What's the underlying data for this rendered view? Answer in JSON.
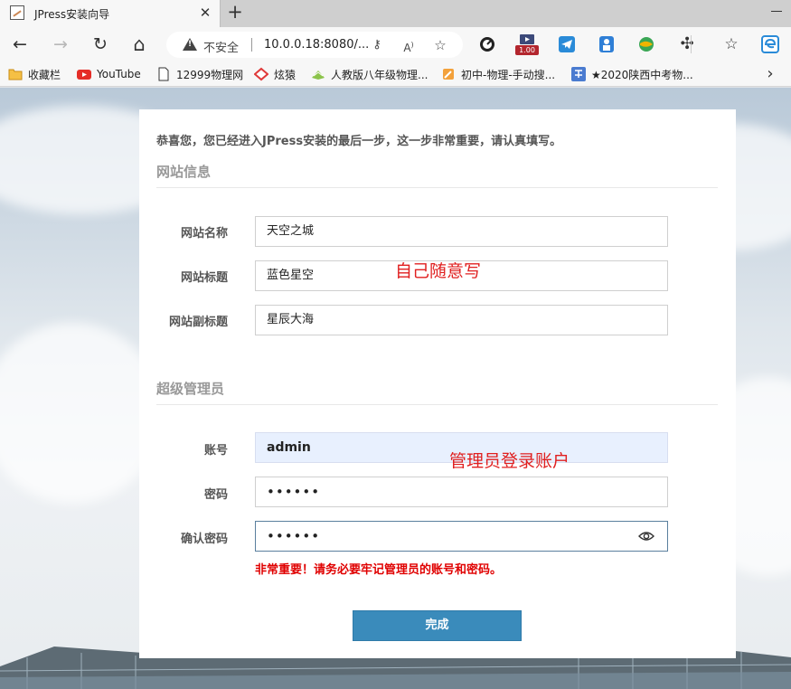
{
  "browser": {
    "tab_title": "JPress安装向导",
    "tab_close": "✕",
    "new_tab": "+",
    "security_label": "不安全",
    "url": "10.0.0.18:8080/...",
    "zoom_badge": "1.00",
    "nav": {
      "back": "←",
      "forward": "→",
      "reload": "↻",
      "home": "⌂"
    },
    "bookmarks": [
      {
        "label": "收藏栏",
        "icon": "folder-icon"
      },
      {
        "label": "YouTube",
        "icon": "youtube-icon"
      },
      {
        "label": "12999物理网",
        "icon": "page-icon"
      },
      {
        "label": "炫猿",
        "icon": "xuanyuan-icon"
      },
      {
        "label": "人教版八年级物理...",
        "icon": "book-icon"
      },
      {
        "label": "初中-物理-手动搜...",
        "icon": "pencil-icon"
      },
      {
        "label": "★2020陕西中考物...",
        "icon": "kao-icon"
      }
    ],
    "more": "›"
  },
  "install": {
    "intro": "恭喜您，您已经进入JPress安装的最后一步，这一步非常重要，请认真填写。",
    "site_section": "网站信息",
    "admin_section": "超级管理员",
    "site_name_label": "网站名称",
    "site_name_value": "天空之城",
    "site_title_label": "网站标题",
    "site_title_value": "蓝色星空",
    "site_subtitle_label": "网站副标题",
    "site_subtitle_value": "星辰大海",
    "account_label": "账号",
    "account_value": "admin",
    "password_label": "密码",
    "password_value": "••••••",
    "confirm_label": "确认密码",
    "confirm_value": "••••••",
    "warning": "非常重要！请务必要牢记管理员的账号和密码。",
    "submit": "完成"
  },
  "annotations": {
    "site_note": "自己随意写",
    "admin_note": "管理员登录账户"
  },
  "colors": {
    "primary_button": "#3a8bbb",
    "warning": "#e00000",
    "annotation": "#e02020",
    "autofill": "#e8f0fe"
  }
}
